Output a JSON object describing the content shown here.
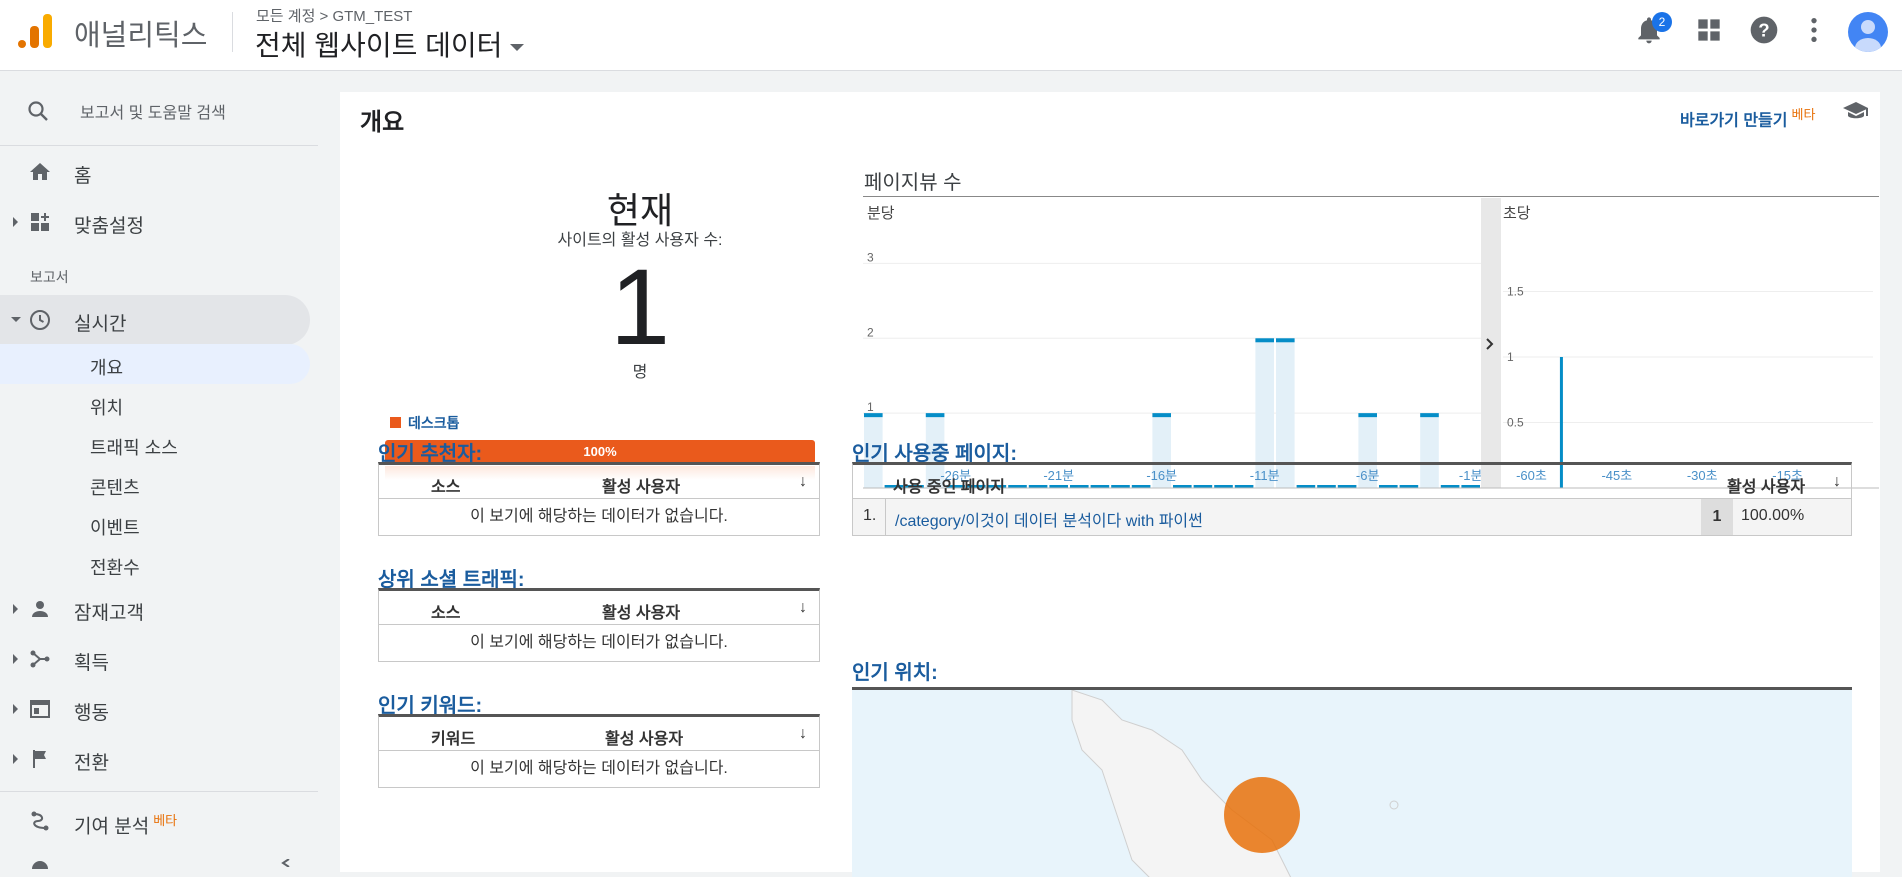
{
  "header": {
    "brand": "애널리틱스",
    "breadcrumb": "모든 계정 > GTM_TEST",
    "view_title": "전체 웹사이트 데이터",
    "notification_count": "2",
    "accent_color": "#1a73e8",
    "logo_color": "#f9ab00",
    "icons": [
      "bell-icon",
      "apps-icon",
      "help-icon",
      "more-vert-icon",
      "avatar"
    ]
  },
  "sidebar": {
    "search_placeholder": "보고서 및 도움말 검색",
    "home": "홈",
    "customization": "맞춤설정",
    "reports_section": "보고서",
    "realtime": "실시간",
    "realtime_items": [
      "개요",
      "위치",
      "트래픽 소스",
      "콘텐츠",
      "이벤트",
      "전환수"
    ],
    "audience": "잠재고객",
    "acquisition": "획득",
    "behavior": "행동",
    "conversions": "전환",
    "attribution": "기여 분석",
    "attribution_beta": "베타"
  },
  "main": {
    "page_title": "개요",
    "shortcut": "바로가기 만들기",
    "shortcut_beta": "베타",
    "now": {
      "title": "현재",
      "subtitle": "사이트의 활성 사용자 수:",
      "value": "1",
      "unit": "명",
      "device_label": "데스크톱",
      "device_percent": "100%",
      "device_color": "#ea5a1c"
    },
    "pageviews_title": "페이지뷰 수",
    "top_referrals": {
      "title": "인기 추천자:",
      "col_source": "소스",
      "col_active": "활성 사용자",
      "empty": "이 보기에 해당하는 데이터가 없습니다."
    },
    "top_social": {
      "title": "상위 소셜 트래픽:",
      "col_source": "소스",
      "col_active": "활성 사용자",
      "empty": "이 보기에 해당하는 데이터가 없습니다."
    },
    "top_keywords": {
      "title": "인기 키워드:",
      "col_keyword": "키워드",
      "col_active": "활성 사용자",
      "empty": "이 보기에 해당하는 데이터가 없습니다."
    },
    "top_pages": {
      "title": "인기 사용중 페이지:",
      "col_page": "사용 중인 페이지",
      "col_active": "활성 사용자",
      "rows": [
        {
          "rank": "1.",
          "page": "/category/이것이 데이터 분석이다 with 파이썬",
          "count": "1",
          "percent": "100.00%"
        }
      ]
    },
    "top_locations": {
      "title": "인기 위치:"
    }
  },
  "chart_data": [
    {
      "type": "bar",
      "title": "분당",
      "x_tick_labels": [
        "-26분",
        "-21분",
        "-16분",
        "-11분",
        "-6분",
        "-1분"
      ],
      "y_tick_labels": [
        "1",
        "2",
        "3"
      ],
      "x": [
        -30,
        -29,
        -28,
        -27,
        -26,
        -25,
        -24,
        -23,
        -22,
        -21,
        -20,
        -19,
        -18,
        -17,
        -16,
        -15,
        -14,
        -13,
        -12,
        -11,
        -10,
        -9,
        -8,
        -7,
        -6,
        -5,
        -4,
        -3,
        -2,
        -1
      ],
      "values": [
        1,
        0,
        0,
        1,
        0,
        0,
        0,
        0,
        0,
        0,
        0,
        0,
        0,
        0,
        1,
        0,
        0,
        0,
        0,
        2,
        2,
        0,
        0,
        0,
        1,
        0,
        0,
        1,
        0,
        0
      ],
      "ylim": [
        0,
        3.5
      ],
      "grid": true,
      "color": "#058dc7"
    },
    {
      "type": "bar",
      "title": "초당",
      "x_tick_labels": [
        "-60초",
        "-45초",
        "-30초",
        "-15초"
      ],
      "y_tick_labels": [
        "0.5",
        "1",
        "1.5"
      ],
      "x": [
        -55
      ],
      "values": [
        1
      ],
      "ylim": [
        0,
        2
      ],
      "grid": true,
      "color": "#058dc7"
    }
  ]
}
